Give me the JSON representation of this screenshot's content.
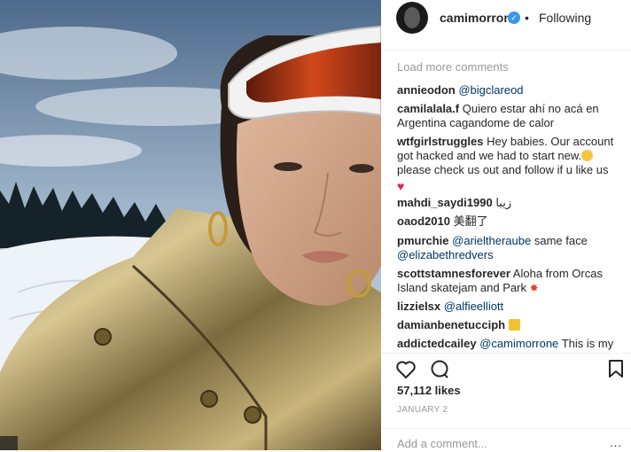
{
  "post": {
    "username": "camimorrone",
    "follow_status": "Following",
    "dot": "•"
  },
  "comments": {
    "load_more": "Load more comments",
    "items": [
      {
        "user": "annieodon",
        "text": "",
        "mention": "@bigclareod"
      },
      {
        "user": "camilalala.f",
        "text": "Quiero estar ahí no acá en Argentina cagandome de calor",
        "mention": ""
      },
      {
        "user": "wtfgirlstruggles",
        "text": "Hey babies. Our account got hacked and we had to start new.",
        "text2": "please check us out and follow if u like us",
        "mention": ""
      },
      {
        "user": "mahdi_saydi1990",
        "text": "زيبا",
        "mention": ""
      },
      {
        "user": "oaod2010",
        "text": "美翻了",
        "mention": ""
      },
      {
        "user": "pmurchie",
        "text": "same face",
        "mention": "@arieltheraube",
        "mention2": "@elizabethredvers"
      },
      {
        "user": "scottstamnesforever",
        "text": "Aloha from Orcas Island skatejam and Park",
        "mention": ""
      },
      {
        "user": "lizzielsx",
        "text": "",
        "mention": "@alfieelliott"
      },
      {
        "user": "damianbenetucciph",
        "text": "",
        "mention": ""
      },
      {
        "user": "addictedcailey",
        "text": "This is my",
        "mention": "@camimorrone"
      }
    ]
  },
  "actions": {
    "likes": "57,112 likes",
    "date": "JANUARY 2",
    "like_icon": "heart-icon",
    "comment_icon": "comment-icon",
    "save_icon": "bookmark-icon"
  },
  "add_comment": {
    "placeholder": "Add a comment...",
    "more": "..."
  },
  "colors": {
    "link": "#003569",
    "verified": "#3897f0",
    "muted": "#999999"
  }
}
